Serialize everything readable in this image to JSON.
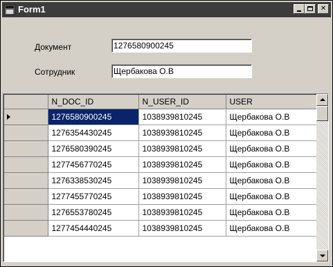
{
  "window": {
    "title": "Form1",
    "icon": "form-icon",
    "controls": [
      "minimize",
      "maximize",
      "close"
    ]
  },
  "form": {
    "document_label": "Документ",
    "document_value": "1276580900245",
    "employee_label": "Сотрудник",
    "employee_value": "Щербакова О.В"
  },
  "grid": {
    "columns": [
      "N_DOC_ID",
      "N_USER_ID",
      "USER"
    ],
    "rows": [
      [
        "1276580900245",
        "1038939810245",
        "Щербакова О.В"
      ],
      [
        "1276354430245",
        "1038939810245",
        "Щербакова О.В"
      ],
      [
        "1276580390245",
        "1038939810245",
        "Щербакова О.В"
      ],
      [
        "1277456770245",
        "1038939810245",
        "Щербакова О.В"
      ],
      [
        "1276338530245",
        "1038939810245",
        "Щербакова О.В"
      ],
      [
        "1277455770245",
        "1038939810245",
        "Щербакова О.В"
      ],
      [
        "1276553780245",
        "1038939810245",
        "Щербакова О.В"
      ],
      [
        "1277454440245",
        "1038939810245",
        "Щербакова О.В"
      ]
    ],
    "current_row_index": 0,
    "colors": {
      "selection": "#0a246a",
      "face": "#d4d0c8",
      "titlebar": "#3c3c3c"
    }
  }
}
